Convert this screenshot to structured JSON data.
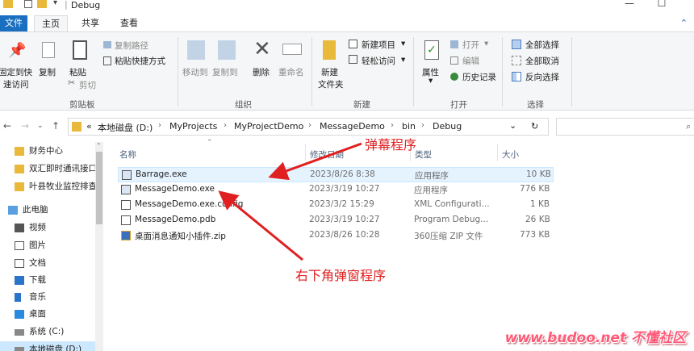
{
  "window": {
    "title": "Debug",
    "minimize_glyph": "—",
    "maximize_glyph": "☐"
  },
  "ribbon_tabs": [
    {
      "label": "文件"
    },
    {
      "label": "主页"
    },
    {
      "label": "共享"
    },
    {
      "label": "查看"
    }
  ],
  "ribbon": {
    "clipboard": {
      "pin_line1": "固定到快",
      "pin_line2": "速访问",
      "copy": "复制",
      "paste": "粘贴",
      "copy_path": "复制路径",
      "paste_shortcut": "粘贴快捷方式",
      "cut": "剪切",
      "group": "剪贴板"
    },
    "organize": {
      "move_to": "移动到",
      "copy_to": "复制到",
      "delete": "删除",
      "rename": "重命名",
      "group": "组织"
    },
    "new": {
      "new_folder_line1": "新建",
      "new_folder_line2": "文件夹",
      "new_item": "新建项目",
      "easy_access": "轻松访问",
      "group": "新建"
    },
    "open": {
      "properties": "属性",
      "open": "打开",
      "edit": "编辑",
      "history": "历史记录",
      "group": "打开"
    },
    "select": {
      "select_all": "全部选择",
      "select_none": "全部取消",
      "invert": "反向选择",
      "group": "选择"
    }
  },
  "address": {
    "overflow": "«",
    "crumbs": [
      "本地磁盘 (D:)",
      "MyProjects",
      "MyProjectDemo",
      "MessageDemo",
      "bin",
      "Debug"
    ]
  },
  "nav_items": [
    {
      "label": "财务中心"
    },
    {
      "label": "双汇即时通讯接口"
    },
    {
      "label": "叶县牧业监控排查"
    },
    {
      "label": "此电脑"
    },
    {
      "label": "视频"
    },
    {
      "label": "图片"
    },
    {
      "label": "文档"
    },
    {
      "label": "下载"
    },
    {
      "label": "音乐"
    },
    {
      "label": "桌面"
    },
    {
      "label": "系统 (C:)"
    },
    {
      "label": "本地磁盘 (D:)"
    }
  ],
  "columns": {
    "name": "名称",
    "date": "修改日期",
    "type": "类型",
    "size": "大小"
  },
  "files": [
    {
      "name": "Barrage.exe",
      "date": "2023/8/26 8:38",
      "type": "应用程序",
      "size": "10 KB"
    },
    {
      "name": "MessageDemo.exe",
      "date": "2023/3/19 10:27",
      "type": "应用程序",
      "size": "776 KB"
    },
    {
      "name": "MessageDemo.exe.config",
      "date": "2023/3/2 15:29",
      "type": "XML Configurati...",
      "size": "1 KB"
    },
    {
      "name": "MessageDemo.pdb",
      "date": "2023/3/19 10:27",
      "type": "Program Debug...",
      "size": "26 KB"
    },
    {
      "name": "桌面消息通知小插件.zip",
      "date": "2023/8/26 10:28",
      "type": "360压缩 ZIP 文件",
      "size": "773 KB"
    }
  ],
  "annotations": {
    "barrage": "弹幕程序",
    "popup": "右下角弹窗程序"
  },
  "watermark": "www.budoo.net 不懂社区",
  "colors": {
    "accent": "#1a6fc1",
    "annotation": "#e02020",
    "selection": "#e5f3ff"
  }
}
